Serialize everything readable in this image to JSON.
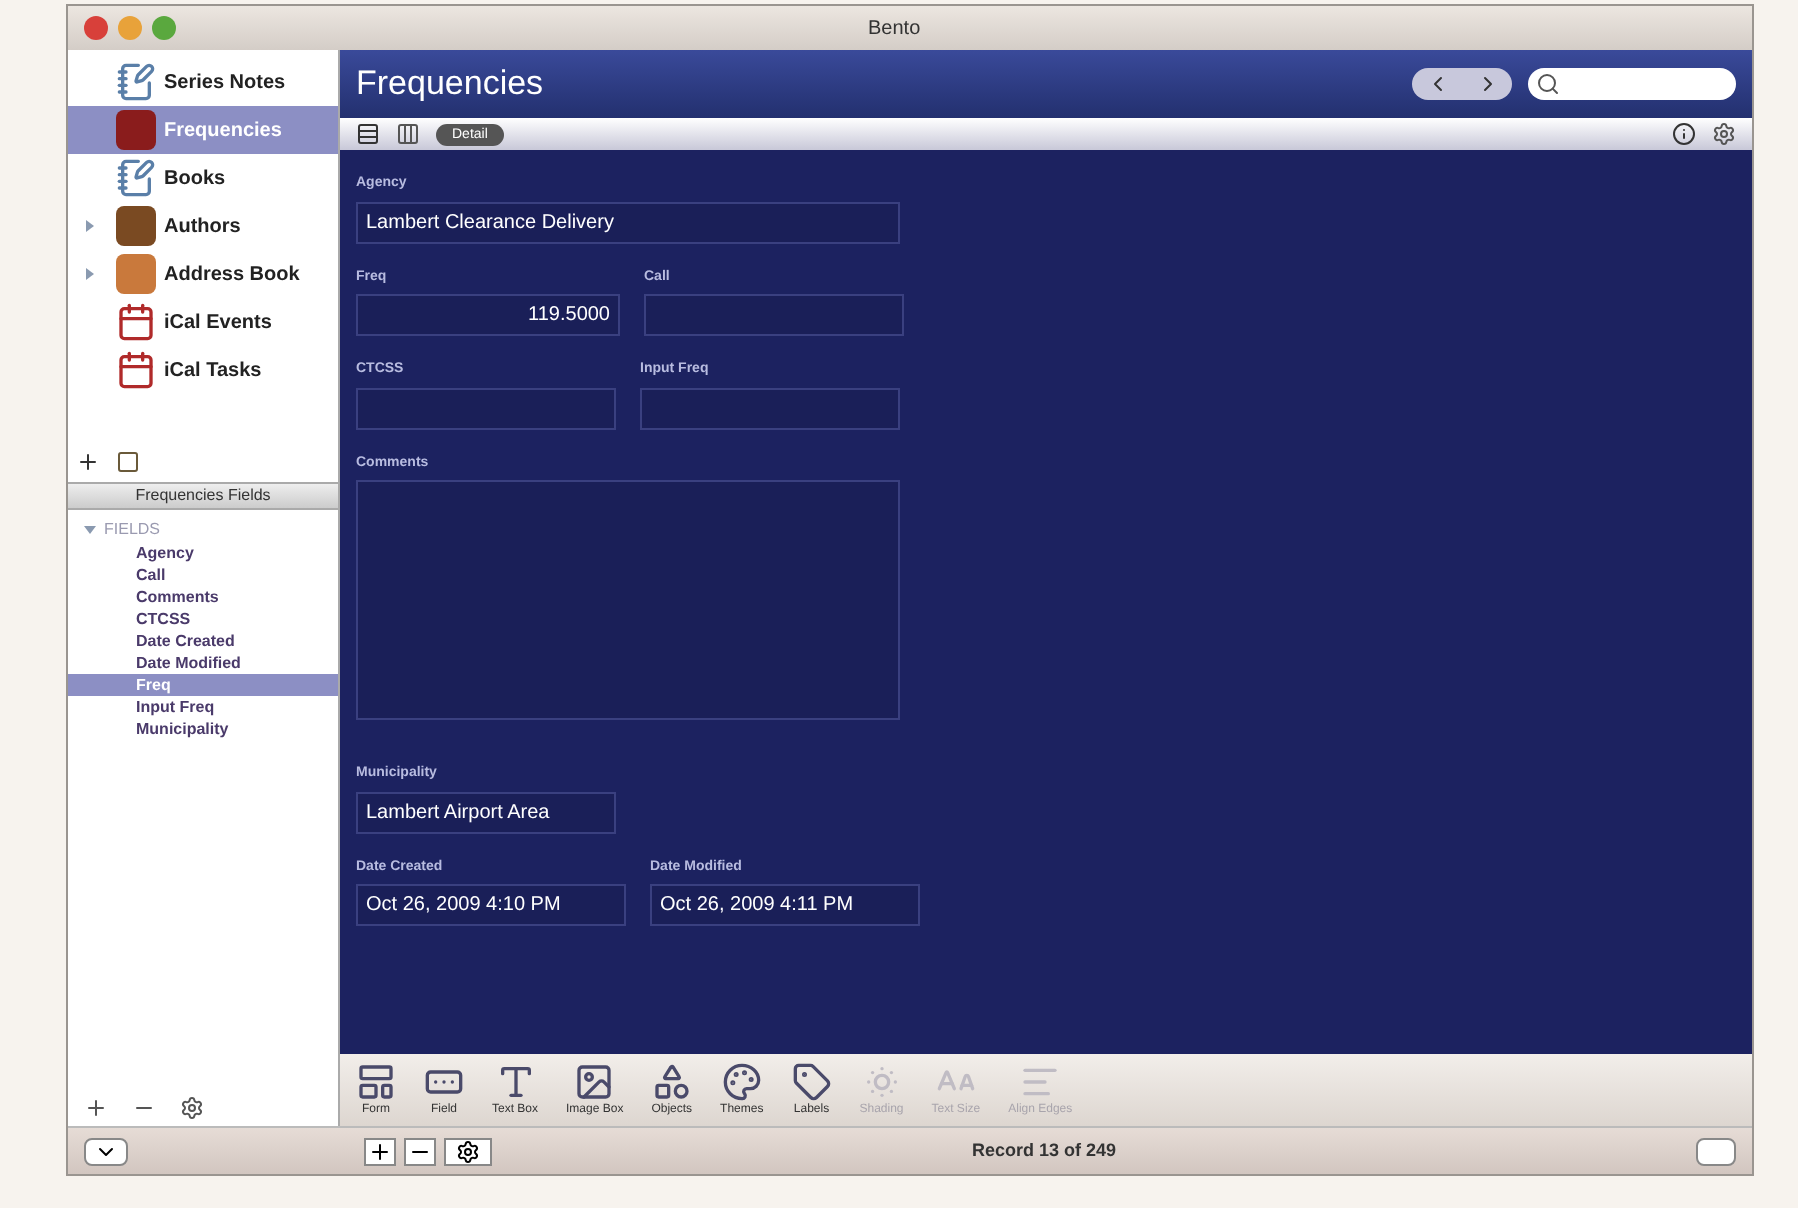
{
  "window": {
    "title": "Bento"
  },
  "library": [
    {
      "label": "Series Notes",
      "selected": false,
      "expandable": false
    },
    {
      "label": "Frequencies",
      "selected": true,
      "expandable": false
    },
    {
      "label": "Books",
      "selected": false,
      "expandable": false
    },
    {
      "label": "Authors",
      "selected": false,
      "expandable": true
    },
    {
      "label": "Address Book",
      "selected": false,
      "expandable": true
    },
    {
      "label": "iCal Events",
      "selected": false,
      "expandable": false
    },
    {
      "label": "iCal Tasks",
      "selected": false,
      "expandable": false
    }
  ],
  "fields_panel": {
    "title": "Frequencies Fields",
    "group": {
      "label": "FIELDS",
      "expanded": true,
      "children": [
        {
          "label": "Agency",
          "selected": false
        },
        {
          "label": "Call",
          "selected": false
        },
        {
          "label": "Comments",
          "selected": false
        },
        {
          "label": "CTCSS",
          "selected": false
        },
        {
          "label": "Date Created",
          "selected": false
        },
        {
          "label": "Date Modified",
          "selected": false
        },
        {
          "label": "Freq",
          "selected": true
        },
        {
          "label": "Input Freq",
          "selected": false
        },
        {
          "label": "Municipality",
          "selected": false
        }
      ]
    }
  },
  "form": {
    "title": "Frequencies",
    "view_button": "Detail",
    "rows": [
      [
        {
          "label": "Agency",
          "value": "Lambert Clearance Delivery",
          "kind": "wide"
        }
      ],
      [
        {
          "label": "Freq",
          "value": "119.5000",
          "kind": "number"
        },
        {
          "label": "Call",
          "kind": "text"
        }
      ],
      [
        {
          "label": "CTCSS",
          "kind": "text"
        },
        {
          "label": "Input Freq",
          "kind": "text"
        }
      ],
      [
        {
          "label": "Comments",
          "kind": "area"
        }
      ],
      [
        {
          "label": "Municipality",
          "value": "Lambert Airport Area",
          "kind": "text"
        }
      ],
      [
        {
          "label": "Date Created",
          "value": "Oct 26, 2009 4:10 PM",
          "kind": "date"
        },
        {
          "label": "Date Modified",
          "value": "Oct 26, 2009 4:11 PM",
          "kind": "date"
        }
      ]
    ]
  },
  "toolbar": [
    {
      "label": "Form",
      "disabled": false
    },
    {
      "label": "Field",
      "disabled": false
    },
    {
      "label": "Text Box",
      "disabled": false
    },
    {
      "label": "Image Box",
      "disabled": false
    },
    {
      "label": "Objects",
      "disabled": false
    },
    {
      "label": "Themes",
      "disabled": false
    },
    {
      "label": "Labels",
      "disabled": false
    },
    {
      "label": "Shading",
      "disabled": true
    },
    {
      "label": "Text Size",
      "disabled": true
    },
    {
      "label": "Align Edges",
      "disabled": true
    }
  ],
  "status_bar": {
    "record": "Record 13 of 249"
  }
}
